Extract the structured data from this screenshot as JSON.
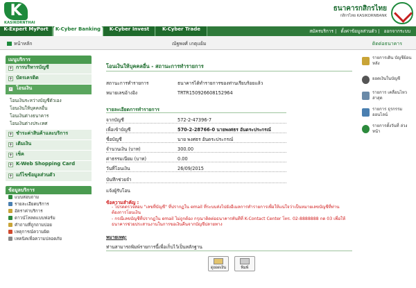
{
  "header": {
    "logo_text": "KASIKORNTHAI",
    "bank_name_th": "ธนาคารกสิกรไทย",
    "bank_name_en": "กสิกรไทย KASIKORNBANK"
  },
  "tabs": [
    "K-Expert MyPort",
    "K-Cyber Banking",
    "K-Cyber Invest",
    "K-Cyber Trade"
  ],
  "top_links": [
    "สมัครบริการ",
    "ตั้งค่าข้อมูลส่วนตัว",
    "ออกจากระบบ"
  ],
  "subbar": {
    "home_label": "หน้าหลัก",
    "username": "ณัฐพงศ์ เกตุแย้ม",
    "contact_label": "ติดต่อธนาคาร"
  },
  "menu": {
    "title": "เมนูบริการ",
    "items": [
      {
        "label": "การบริหารบัญชี",
        "icon": "+"
      },
      {
        "label": "บัตรเครดิต",
        "icon": "+"
      },
      {
        "label": "โอนเงิน",
        "icon": "-"
      },
      {
        "label": "ชำระค่าสินค้าและบริการ",
        "icon": "+"
      },
      {
        "label": "เติมเงิน",
        "icon": "+"
      },
      {
        "label": "เช็ค",
        "icon": "+"
      },
      {
        "label": "K-Web Shopping Card",
        "icon": "+"
      },
      {
        "label": "แก้ไขข้อมูลส่วนตัว",
        "icon": "+"
      }
    ],
    "transfer_sub": [
      "โอนเงินระหว่างบัญชีตัวเอง",
      "โอนเงินให้บุคคลอื่น",
      "โอนเงินต่างธนาคาร",
      "โอนเงินต่างประเทศ"
    ]
  },
  "services": {
    "title": "ข้อมูลบริการ",
    "items": [
      {
        "label": "แบบสอบถาม",
        "color": "#2c8a3c"
      },
      {
        "label": "รายละเอียดบริการ",
        "color": "#4a7fb0"
      },
      {
        "label": "อัตราค่าบริการ",
        "color": "#c9a437"
      },
      {
        "label": "ดาวน์โหลดแบบฟอร์ม",
        "color": "#2c8a3c"
      },
      {
        "label": "คำถามที่ถูกถามบ่อย",
        "color": "#c9a437"
      },
      {
        "label": "เหตุการณ์ความผิด",
        "color": "#d04a2e"
      },
      {
        "label": "เทคนิคเพื่อความปลอดภัย",
        "color": "#8a8a8a"
      }
    ]
  },
  "main": {
    "page_title": "โอนเงินให้บุคคลอื่น - สถานะการทำรายการ",
    "status_label": "สถานะการทำรายการ",
    "status_value": "ธนาคารได้ทำรายการของท่านเรียบร้อยแล้ว",
    "ref_label": "หมายเลขอ้างอิง",
    "ref_value": "TRTR150926608152964",
    "details_heading": "รายละเอียดการทำรายการ",
    "from_label": "จากบัญชี",
    "from_value": "572-2-47396-7",
    "to_label": "เพื่อเข้าบัญชี",
    "to_value": "570-2-28766-0 นายพงศธร อันดระประกรณ์",
    "name_label": "ชื่อบัญชี",
    "name_value": "นาย พงศธร อันดระประกรณ์",
    "amount_label": "จำนวนเงิน (บาท)",
    "amount_value": "300.00",
    "fee_label": "ค่าธรรมเนียม (บาท)",
    "fee_value": "0.00",
    "date_label": "วันที่โอนเงิน",
    "date_value": "26/09/2015",
    "memo_label": "บันทึกช่วยจำ",
    "notify_label": "แจ้งผู้รับโอน",
    "warning_heading": "ข้อความสำคัญ :",
    "warning_1": "- โปรดตรวจสอบ \"เลขที่บัญชี\" ที่ปรากฏใน email ที่ระบบส่งไปยังอีเมลการทำรายการเพื่อให้แน่ใจว่าเป็นหมายเลขบัญชีที่ท่านต้องการโอนเงิน",
    "warning_2": "- กรณีเลขบัญชีที่ปรากฏใน email ไม่ถูกต้อง กรุณาติดต่อธนาคารทันทีที่ K-Contact Center โทร. 02-8888888 กด 03 เพื่อให้ธนาคารช่วยประสานงานในการขอเงินคืนจากบัญชีปลายทาง",
    "note_heading": "หมายเหตุ:",
    "note_text": "ท่านสามารถพิมพ์รายการนี้เพื่อเก็บไว้เป็นหลักฐาน",
    "btn_view": "ดูยอดเงิน",
    "btn_print": "พิมพ์"
  },
  "right": [
    {
      "label": "รายการเดิน บัญชีย้อนหลัง",
      "color": "#c9a437"
    },
    {
      "label": "ยอดเงินในบัญชี",
      "color": "#555"
    },
    {
      "label": "รายการ เคลื่อนไหวล่าสุด",
      "color": "#6a8aa8"
    },
    {
      "label": "รายการ ธุรกรรมออนไลน์",
      "color": "#4a7fb0"
    },
    {
      "label": "รายการตั้งวันที่ ล่วงหน้า",
      "color": "#2c8a3c"
    }
  ]
}
